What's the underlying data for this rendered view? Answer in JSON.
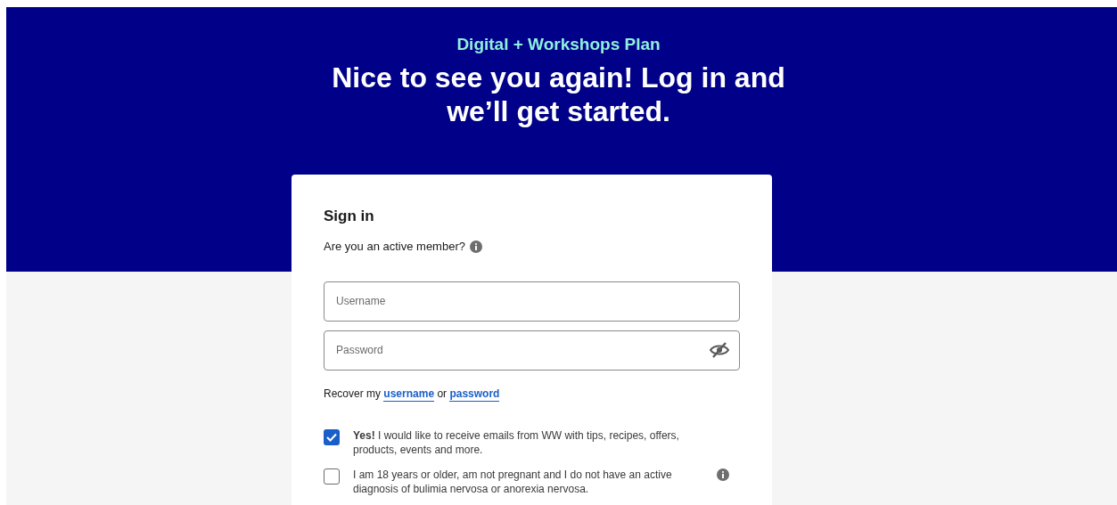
{
  "hero": {
    "plan": "Digital + Workshops Plan",
    "heading": "Nice to see you again! Log in and we’ll get started."
  },
  "card": {
    "title": "Sign in",
    "subtitle": "Are you an active member?",
    "fields": [
      {
        "kind": "text",
        "placeholder": "Username"
      },
      {
        "kind": "password",
        "placeholder": "Password"
      }
    ],
    "recover": {
      "prefix": "Recover my",
      "username_link": "username",
      "joiner": "or",
      "password_link": "password"
    },
    "consents": [
      {
        "text": "**Yes!** I would like to receive emails from WW with tips, recipes, offers, products, events and more.",
        "checked": true,
        "info": false
      },
      {
        "text": "I am 18 years or older, am not pregnant and I do not have an active diagnosis of bulimia nervosa or anorexia nervosa.",
        "checked": false,
        "info": true
      }
    ]
  }
}
